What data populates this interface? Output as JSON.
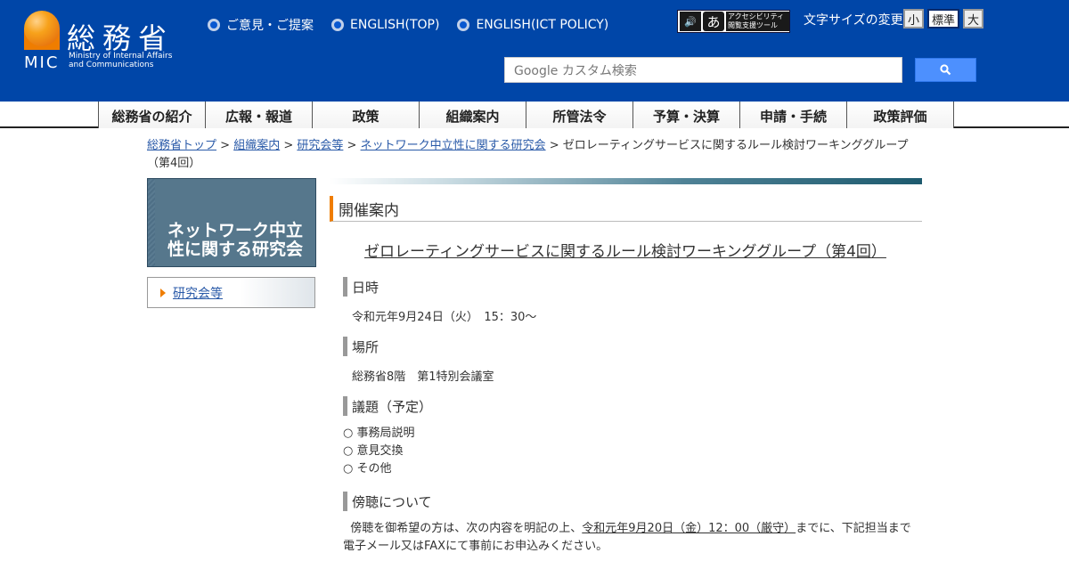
{
  "header": {
    "logo_kanji": "総務省",
    "logo_mic": "MIC",
    "logo_en_line1": "Ministry of Internal Affairs",
    "logo_en_line2": "and Communications",
    "top_links": [
      "ご意見・ご提案",
      "ENGLISH(TOP)",
      "ENGLISH(ICT POLICY)"
    ],
    "accessibility_line1": "アクセシビリティ",
    "accessibility_line2": "閲覧支援ツール",
    "font_size_label": "文字サイズの変更",
    "font_sizes": [
      "小",
      "標準",
      "大"
    ],
    "search_placeholder": "Google カスタム検索",
    "search_icon": "search-icon"
  },
  "nav": [
    "総務省の紹介",
    "広報・報道",
    "政策",
    "組織案内",
    "所管法令",
    "予算・決算",
    "申請・手続",
    "政策評価"
  ],
  "breadcrumb": {
    "links": [
      "総務省トップ",
      "組織案内",
      "研究会等",
      "ネットワーク中立性に関する研究会"
    ],
    "separator": " > ",
    "current": "ゼロレーティングサービスに関するルール検討ワーキンググループ（第4回）"
  },
  "sidebar": {
    "title_line1": "ネットワーク中立",
    "title_line2": "性に関する研究会",
    "link": "研究会等"
  },
  "main": {
    "section_heading": "開催案内",
    "title": "ゼロレーティングサービスに関するルール検討ワーキンググループ（第4回）",
    "datetime_heading": "日時",
    "datetime": "令和元年9月24日（火）　15：30～",
    "place_heading": "場所",
    "place": "総務省8階　第1特別会議室",
    "agenda_heading": "議題（予定）",
    "agenda": [
      "事務局説明",
      "意見交換",
      "その他"
    ],
    "observe_heading": "傍聴について",
    "observe_text_1": "傍聴を御希望の方は、次の内容を明記の上、",
    "observe_deadline": "令和元年9月20日（金）12：00（厳守）",
    "observe_text_2": "までに、下記担当まで電子メール又はFAXにて事前にお申込みください。"
  },
  "colors": {
    "header_bg": "#0046a8",
    "accent_orange": "#ef7d00",
    "link": "#2a5aa8"
  }
}
